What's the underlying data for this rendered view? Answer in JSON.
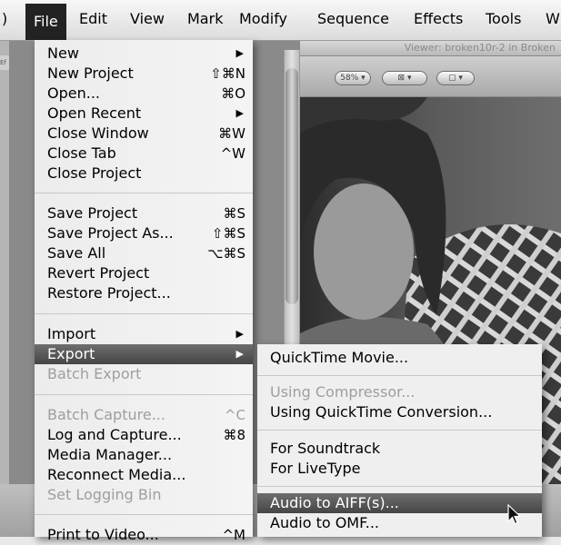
{
  "menubar": {
    "items": [
      {
        "id": "apple",
        "label": ")"
      },
      {
        "id": "file",
        "label": "File"
      },
      {
        "id": "edit",
        "label": "Edit"
      },
      {
        "id": "view",
        "label": "View"
      },
      {
        "id": "mark",
        "label": "Mark"
      },
      {
        "id": "modify",
        "label": "Modify"
      },
      {
        "id": "sequence",
        "label": "Sequence"
      },
      {
        "id": "effects",
        "label": "Effects"
      },
      {
        "id": "tools",
        "label": "Tools"
      },
      {
        "id": "window",
        "label": "W"
      }
    ],
    "active": "File"
  },
  "background": {
    "viewer_title": "Viewer: broken10r-2 in Broken",
    "zoom_label": "58%",
    "view_mode_label": "",
    "overlay_label": "",
    "left_tab_label": "Ef"
  },
  "file_menu": {
    "groups": [
      [
        {
          "label": "New",
          "shortcut": "",
          "submenu": true,
          "enabled": true
        },
        {
          "label": "New Project",
          "shortcut": "⇧⌘N",
          "submenu": false,
          "enabled": true
        },
        {
          "label": "Open...",
          "shortcut": "⌘O",
          "submenu": false,
          "enabled": true
        },
        {
          "label": "Open Recent",
          "shortcut": "",
          "submenu": true,
          "enabled": true
        },
        {
          "label": "Close Window",
          "shortcut": "⌘W",
          "submenu": false,
          "enabled": true
        },
        {
          "label": "Close Tab",
          "shortcut": "^W",
          "submenu": false,
          "enabled": true
        },
        {
          "label": "Close Project",
          "shortcut": "",
          "submenu": false,
          "enabled": true
        }
      ],
      [
        {
          "label": "Save Project",
          "shortcut": "⌘S",
          "submenu": false,
          "enabled": true
        },
        {
          "label": "Save Project As...",
          "shortcut": "⇧⌘S",
          "submenu": false,
          "enabled": true
        },
        {
          "label": "Save All",
          "shortcut": "⌥⌘S",
          "submenu": false,
          "enabled": true
        },
        {
          "label": "Revert Project",
          "shortcut": "",
          "submenu": false,
          "enabled": true
        },
        {
          "label": "Restore Project...",
          "shortcut": "",
          "submenu": false,
          "enabled": true
        }
      ],
      [
        {
          "label": "Import",
          "shortcut": "",
          "submenu": true,
          "enabled": true
        },
        {
          "label": "Export",
          "shortcut": "",
          "submenu": true,
          "enabled": true,
          "highlighted": true
        },
        {
          "label": "Batch Export",
          "shortcut": "",
          "submenu": false,
          "enabled": false
        }
      ],
      [
        {
          "label": "Batch Capture...",
          "shortcut": "^C",
          "submenu": false,
          "enabled": false
        },
        {
          "label": "Log and Capture...",
          "shortcut": "⌘8",
          "submenu": false,
          "enabled": true
        },
        {
          "label": "Media Manager...",
          "shortcut": "",
          "submenu": false,
          "enabled": true
        },
        {
          "label": "Reconnect Media...",
          "shortcut": "",
          "submenu": false,
          "enabled": true
        },
        {
          "label": "Set Logging Bin",
          "shortcut": "",
          "submenu": false,
          "enabled": false
        }
      ],
      [
        {
          "label": "Print to Video...",
          "shortcut": "^M",
          "submenu": false,
          "enabled": true
        }
      ]
    ]
  },
  "export_submenu": {
    "groups": [
      [
        {
          "label": "QuickTime Movie...",
          "enabled": true
        }
      ],
      [
        {
          "label": "Using Compressor...",
          "enabled": false
        },
        {
          "label": "Using QuickTime Conversion...",
          "enabled": true
        }
      ],
      [
        {
          "label": "For Soundtrack",
          "enabled": true
        },
        {
          "label": "For LiveType",
          "enabled": true
        }
      ],
      [
        {
          "label": "Audio to AIFF(s)...",
          "enabled": true,
          "highlighted": true
        },
        {
          "label": "Audio to OMF...",
          "enabled": true
        }
      ]
    ]
  },
  "colors": {
    "highlight": "#555555",
    "disabled_text": "#9e9e9e",
    "menu_bg": "#f0f0f0"
  }
}
